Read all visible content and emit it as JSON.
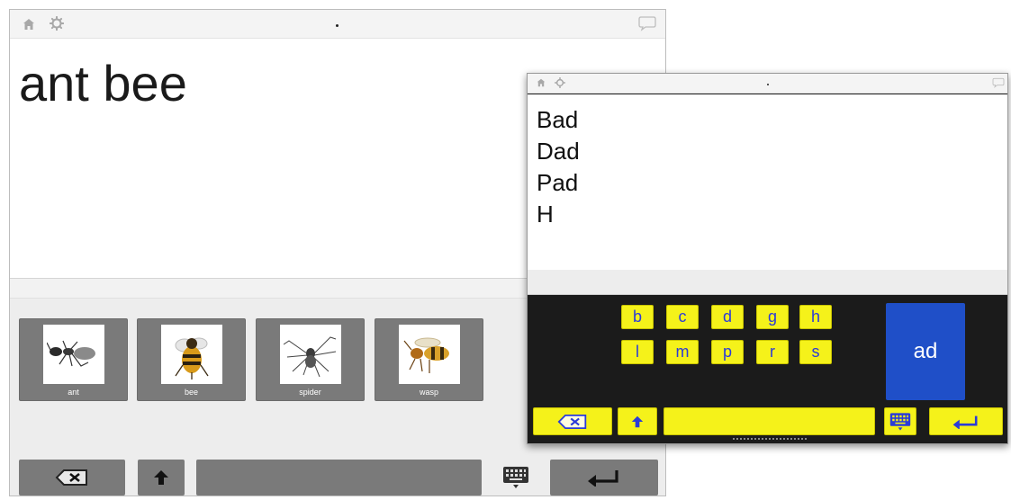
{
  "left_screen": {
    "document_text": "ant bee",
    "pictures": [
      {
        "label": "ant",
        "image": "ant-picture"
      },
      {
        "label": "bee",
        "image": "bee-picture"
      },
      {
        "label": "spider",
        "image": "spider-picture"
      },
      {
        "label": "wasp",
        "image": "wasp-picture"
      }
    ],
    "toolbar": {
      "icons": [
        "home-icon",
        "gear-icon",
        "chat-bubble-icon"
      ],
      "bottom_keys": [
        "backspace-icon",
        "shift-arrow-icon",
        "space-bar",
        "keyboard-icon",
        "return-icon"
      ]
    }
  },
  "right_screen": {
    "lines": [
      "Bad",
      "Dad",
      "Pad",
      "H"
    ],
    "letter_keys_row1": [
      "b",
      "c",
      "d",
      "g",
      "h"
    ],
    "letter_keys_row2": [
      "l",
      "m",
      "p",
      "r",
      "s"
    ],
    "suggestion": "ad",
    "toolbar": {
      "icons": [
        "home-icon",
        "gear-icon",
        "chat-bubble-icon"
      ],
      "bottom_keys": [
        "backspace-icon",
        "shift-arrow-icon",
        "space-bar",
        "keyboard-icon",
        "return-icon"
      ]
    },
    "colors": {
      "key_yellow": "#f5f21a",
      "key_text_blue": "#2b3bd8",
      "suggestion_blue": "#1f4fc8",
      "keyboard_bg": "#1b1b1b"
    }
  }
}
